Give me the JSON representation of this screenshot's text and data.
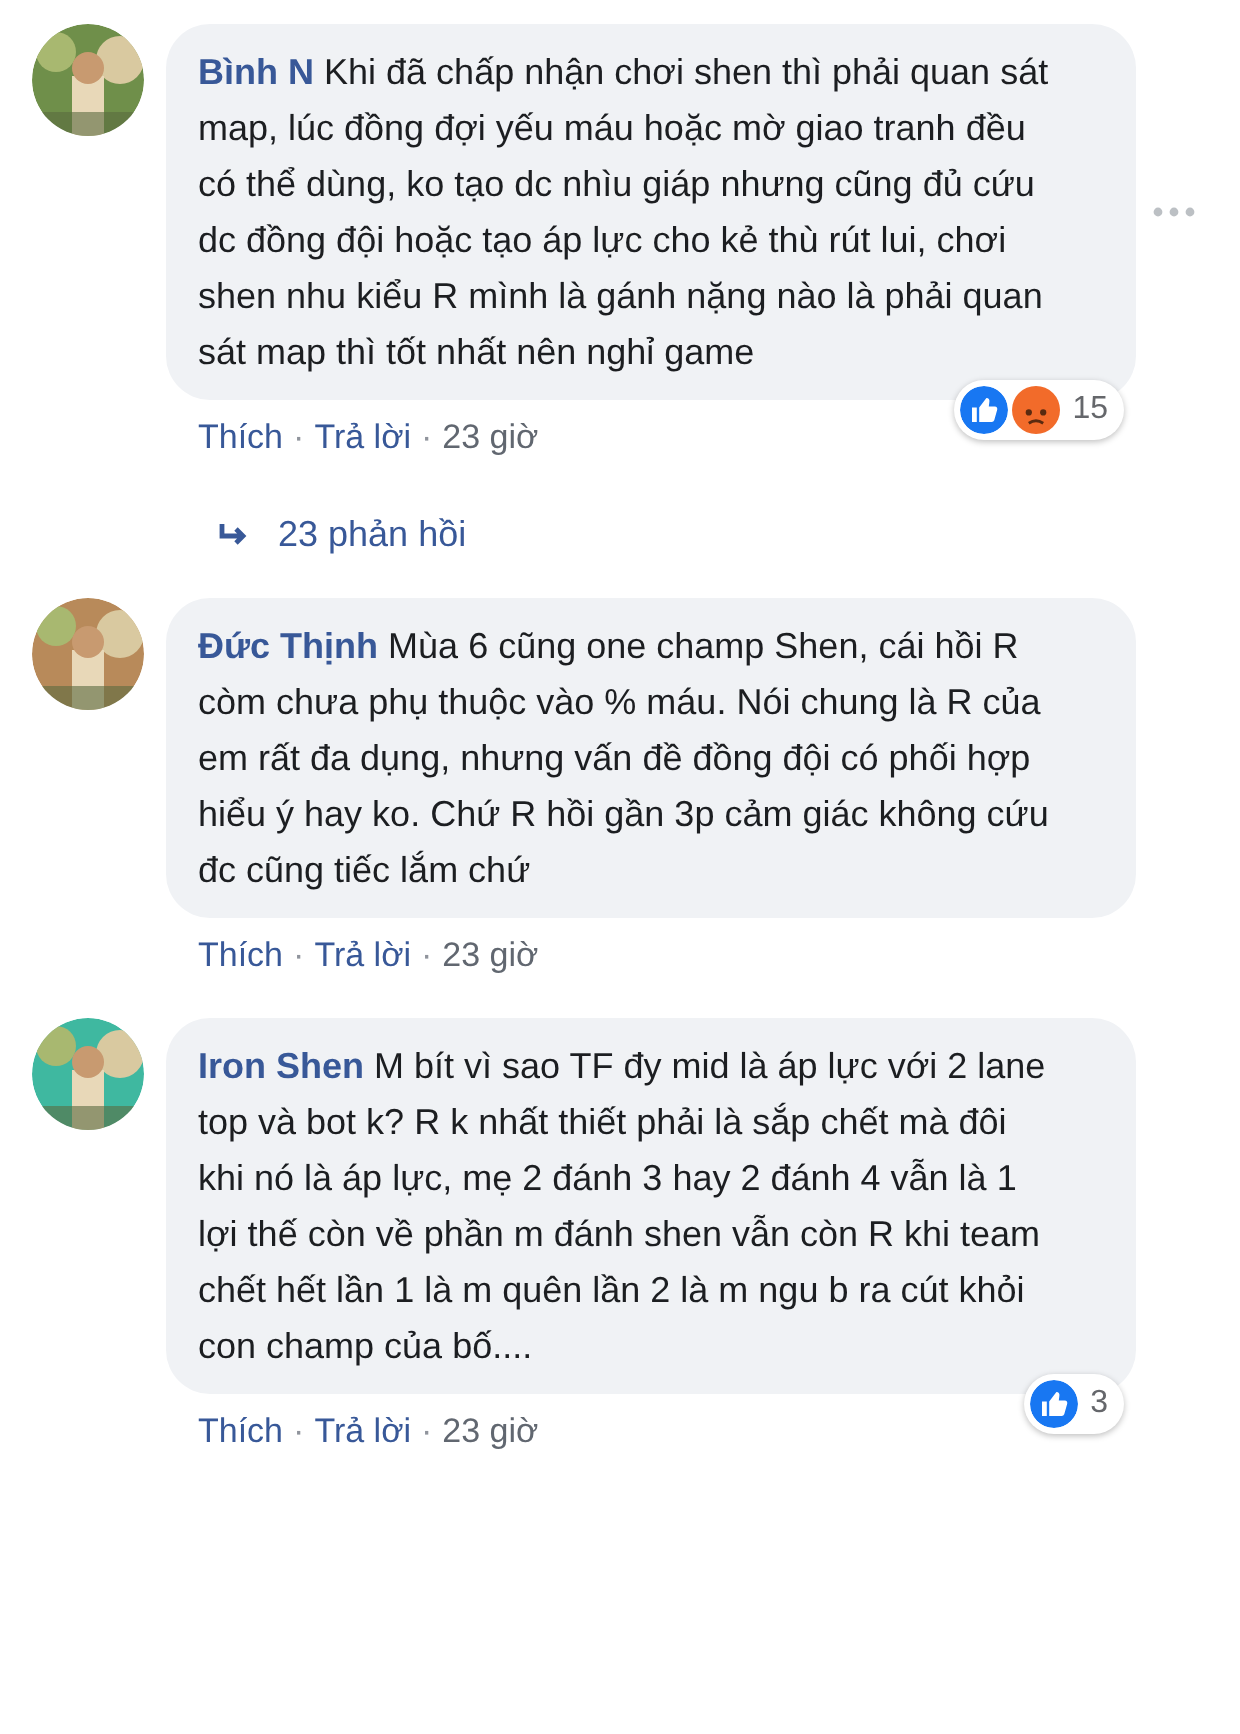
{
  "comments": [
    {
      "author": "Bình N",
      "body": "Khi đã chấp nhận chơi shen thì phải quan sát map, lúc đồng đợi yếu máu hoặc mờ giao tranh đều có thể dùng, ko tạo dc nhìu giáp nhưng cũng đủ cứu dc đồng đội hoặc tạo áp lực cho kẻ thù rút lui, chơi shen nhu kiểu R mình là gánh nặng nào là phải quan sát map thì tốt nhất nên nghỉ game",
      "reactions": [
        {
          "kind": "like"
        },
        {
          "kind": "angry"
        }
      ],
      "reaction_count": "15",
      "more": true,
      "actions": [
        "Thích",
        "Trả lời"
      ],
      "separators": [
        "·",
        "·"
      ],
      "time": "23 giờ",
      "replies": "23 phản hồi"
    },
    {
      "author": "Đức Thịnh",
      "body": "Mùa 6 cũng one champ Shen, cái hồi R còm chưa phụ thuộc vào % máu. Nói chung là R của em rất đa dụng, nhưng vấn đề đồng đội có phối hợp hiểu ý hay ko. Chứ R hồi gần 3p cảm giác không cứu đc cũng tiếc lắm chứ",
      "actions": [
        "Thích",
        "Trả lời"
      ],
      "separators": [
        "·",
        "·"
      ],
      "time": "23 giờ"
    },
    {
      "author": "Iron Shen",
      "body": "M bít vì sao TF đy mid là áp lực với 2 lane top và bot k? R k nhất thiết phải là sắp chết mà đôi khi nó là áp lực, mẹ 2 đánh 3 hay 2 đánh 4 vẫn là 1 lợi thế còn về phần m đánh shen vẫn còn R khi team chết hết lần 1 là m quên lần 2 là m ngu b    ra cút khỏi con champ của bố....",
      "reactions": [
        {
          "kind": "like"
        }
      ],
      "reaction_count": "3",
      "actions": [
        "Thích",
        "Trả lời"
      ],
      "separators": [
        "·",
        "·"
      ],
      "time": "23 giờ"
    }
  ]
}
